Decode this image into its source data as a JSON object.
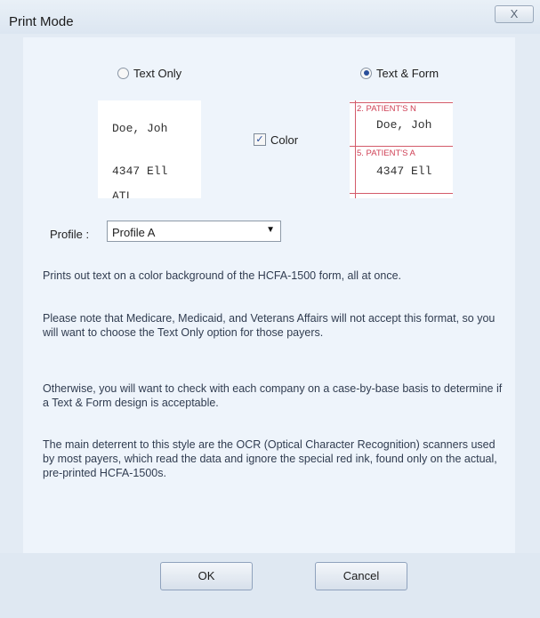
{
  "window": {
    "title": "Print Mode",
    "close_glyph": "X"
  },
  "mode": {
    "text_only_label": "Text Only",
    "text_form_label": "Text & Form",
    "selected": "Text & Form"
  },
  "preview_text_only": {
    "line1": "Doe, Joh",
    "line2": "4347 Ell",
    "line3": "ATL"
  },
  "preview_text_form": {
    "label1": "2. PATIENT'S N",
    "line1": "Doe, Joh",
    "label2": "5. PATIENT'S A",
    "line2": "4347 Ell"
  },
  "color": {
    "label": "Color",
    "checked": true,
    "check_glyph": "✓"
  },
  "profile": {
    "label": "Profile :",
    "value": "Profile A",
    "arrow_glyph": "▼"
  },
  "description": {
    "p1": "Prints out text on a color background of the HCFA-1500 form, all at once.",
    "p2": "Please note that Medicare, Medicaid, and Veterans Affairs will not accept this format, so you will want to choose the Text Only option for those payers.",
    "p3": "Otherwise, you will want to check with each company on a case-by-base basis to determine if a Text & Form design is acceptable.",
    "p4": "The main deterrent to this style are the OCR (Optical Character Recognition) scanners used by most payers, which read the data and ignore the special red ink, found only on the actual, pre-printed HCFA-1500s."
  },
  "buttons": {
    "ok": "OK",
    "cancel": "Cancel"
  },
  "colors": {
    "form_red": "#cf3f54",
    "accent_blue": "#2a4f9a"
  }
}
